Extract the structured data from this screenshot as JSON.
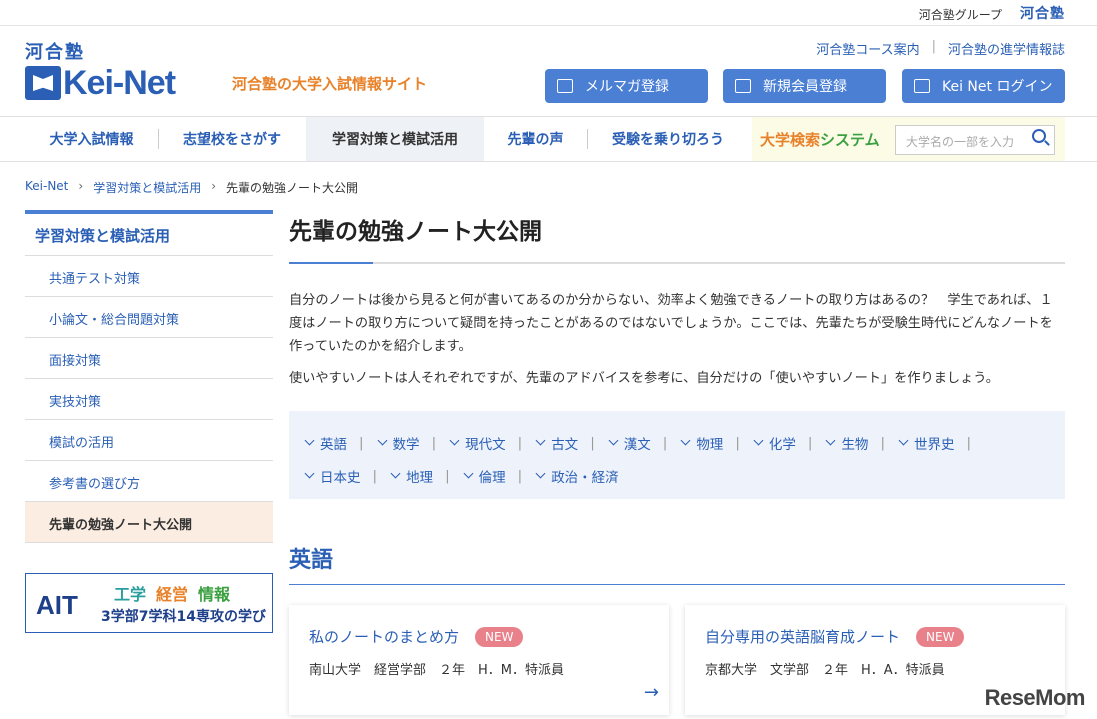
{
  "topbar": {
    "group_label": "河合塾グループ",
    "group_logo": "河合塾"
  },
  "logo": {
    "kanji": "河合塾",
    "name": "Kei-Net",
    "tagline": "河合塾の大学入試情報サイト"
  },
  "header_links": [
    "河合塾コース案内",
    "河合塾の進学情報誌"
  ],
  "header_buttons": [
    {
      "label": "メルマガ登録",
      "icon": "mail-icon"
    },
    {
      "label": "新規会員登録",
      "icon": "user-icon"
    },
    {
      "label": "Kei Net ログイン",
      "icon": "login-icon"
    }
  ],
  "nav": {
    "items": [
      "大学入試情報",
      "志望校をさがす",
      "学習対策と模試活用",
      "先輩の声",
      "受験を乗り切ろう"
    ],
    "active_index": 2,
    "system_a": "大学検索",
    "system_b": "システム",
    "search_placeholder": "大学名の一部を入力"
  },
  "breadcrumb": [
    "Kei-Net",
    "学習対策と模試活用",
    "先輩の勉強ノート大公開"
  ],
  "sidebar": {
    "heading": "学習対策と模試活用",
    "items": [
      "共通テスト対策",
      "小論文・総合問題対策",
      "面接対策",
      "実技対策",
      "模試の活用",
      "参考書の選び方",
      "先輩の勉強ノート大公開"
    ],
    "active_index": 6
  },
  "banner": {
    "brand": "AIT",
    "w1": "工学",
    "w2": "経営",
    "w3": "情報",
    "line2": "3学部7学科14専攻の学び"
  },
  "main": {
    "title": "先輩の勉強ノート大公開",
    "intro": "自分のノートは後から見ると何が書いてあるのか分からない、効率よく勉強できるノートの取り方はあるの？　学生であれば、１度はノートの取り方について疑問を持ったことがあるのではないでしょうか。ここでは、先輩たちが受験生時代にどんなノートを作っていたのかを紹介します。",
    "intro2": "使いやすいノートは人それぞれですが、先輩のアドバイスを参考に、自分だけの「使いやすいノート」を作りましょう。",
    "subjects_row1": [
      "英語",
      "数学",
      "現代文",
      "古文",
      "漢文",
      "物理",
      "化学",
      "生物",
      "世界史"
    ],
    "subjects_row2": [
      "日本史",
      "地理",
      "倫理",
      "政治・経済"
    ],
    "section_title": "英語",
    "cards": [
      {
        "title": "私のノートのまとめ方",
        "badge": "NEW",
        "meta": "南山大学　経営学部　２年　H．M．特派員"
      },
      {
        "title": "自分専用の英語脳育成ノート",
        "badge": "NEW",
        "meta": "京都大学　文学部　２年　H．A．特派員"
      }
    ]
  },
  "watermark": "ReseMom",
  "colors": {
    "brand_blue": "#2a5fb5",
    "button_blue": "#4a7fd4",
    "orange": "#e8822a",
    "green": "#3aa040",
    "badge_pink": "#e9818b"
  }
}
